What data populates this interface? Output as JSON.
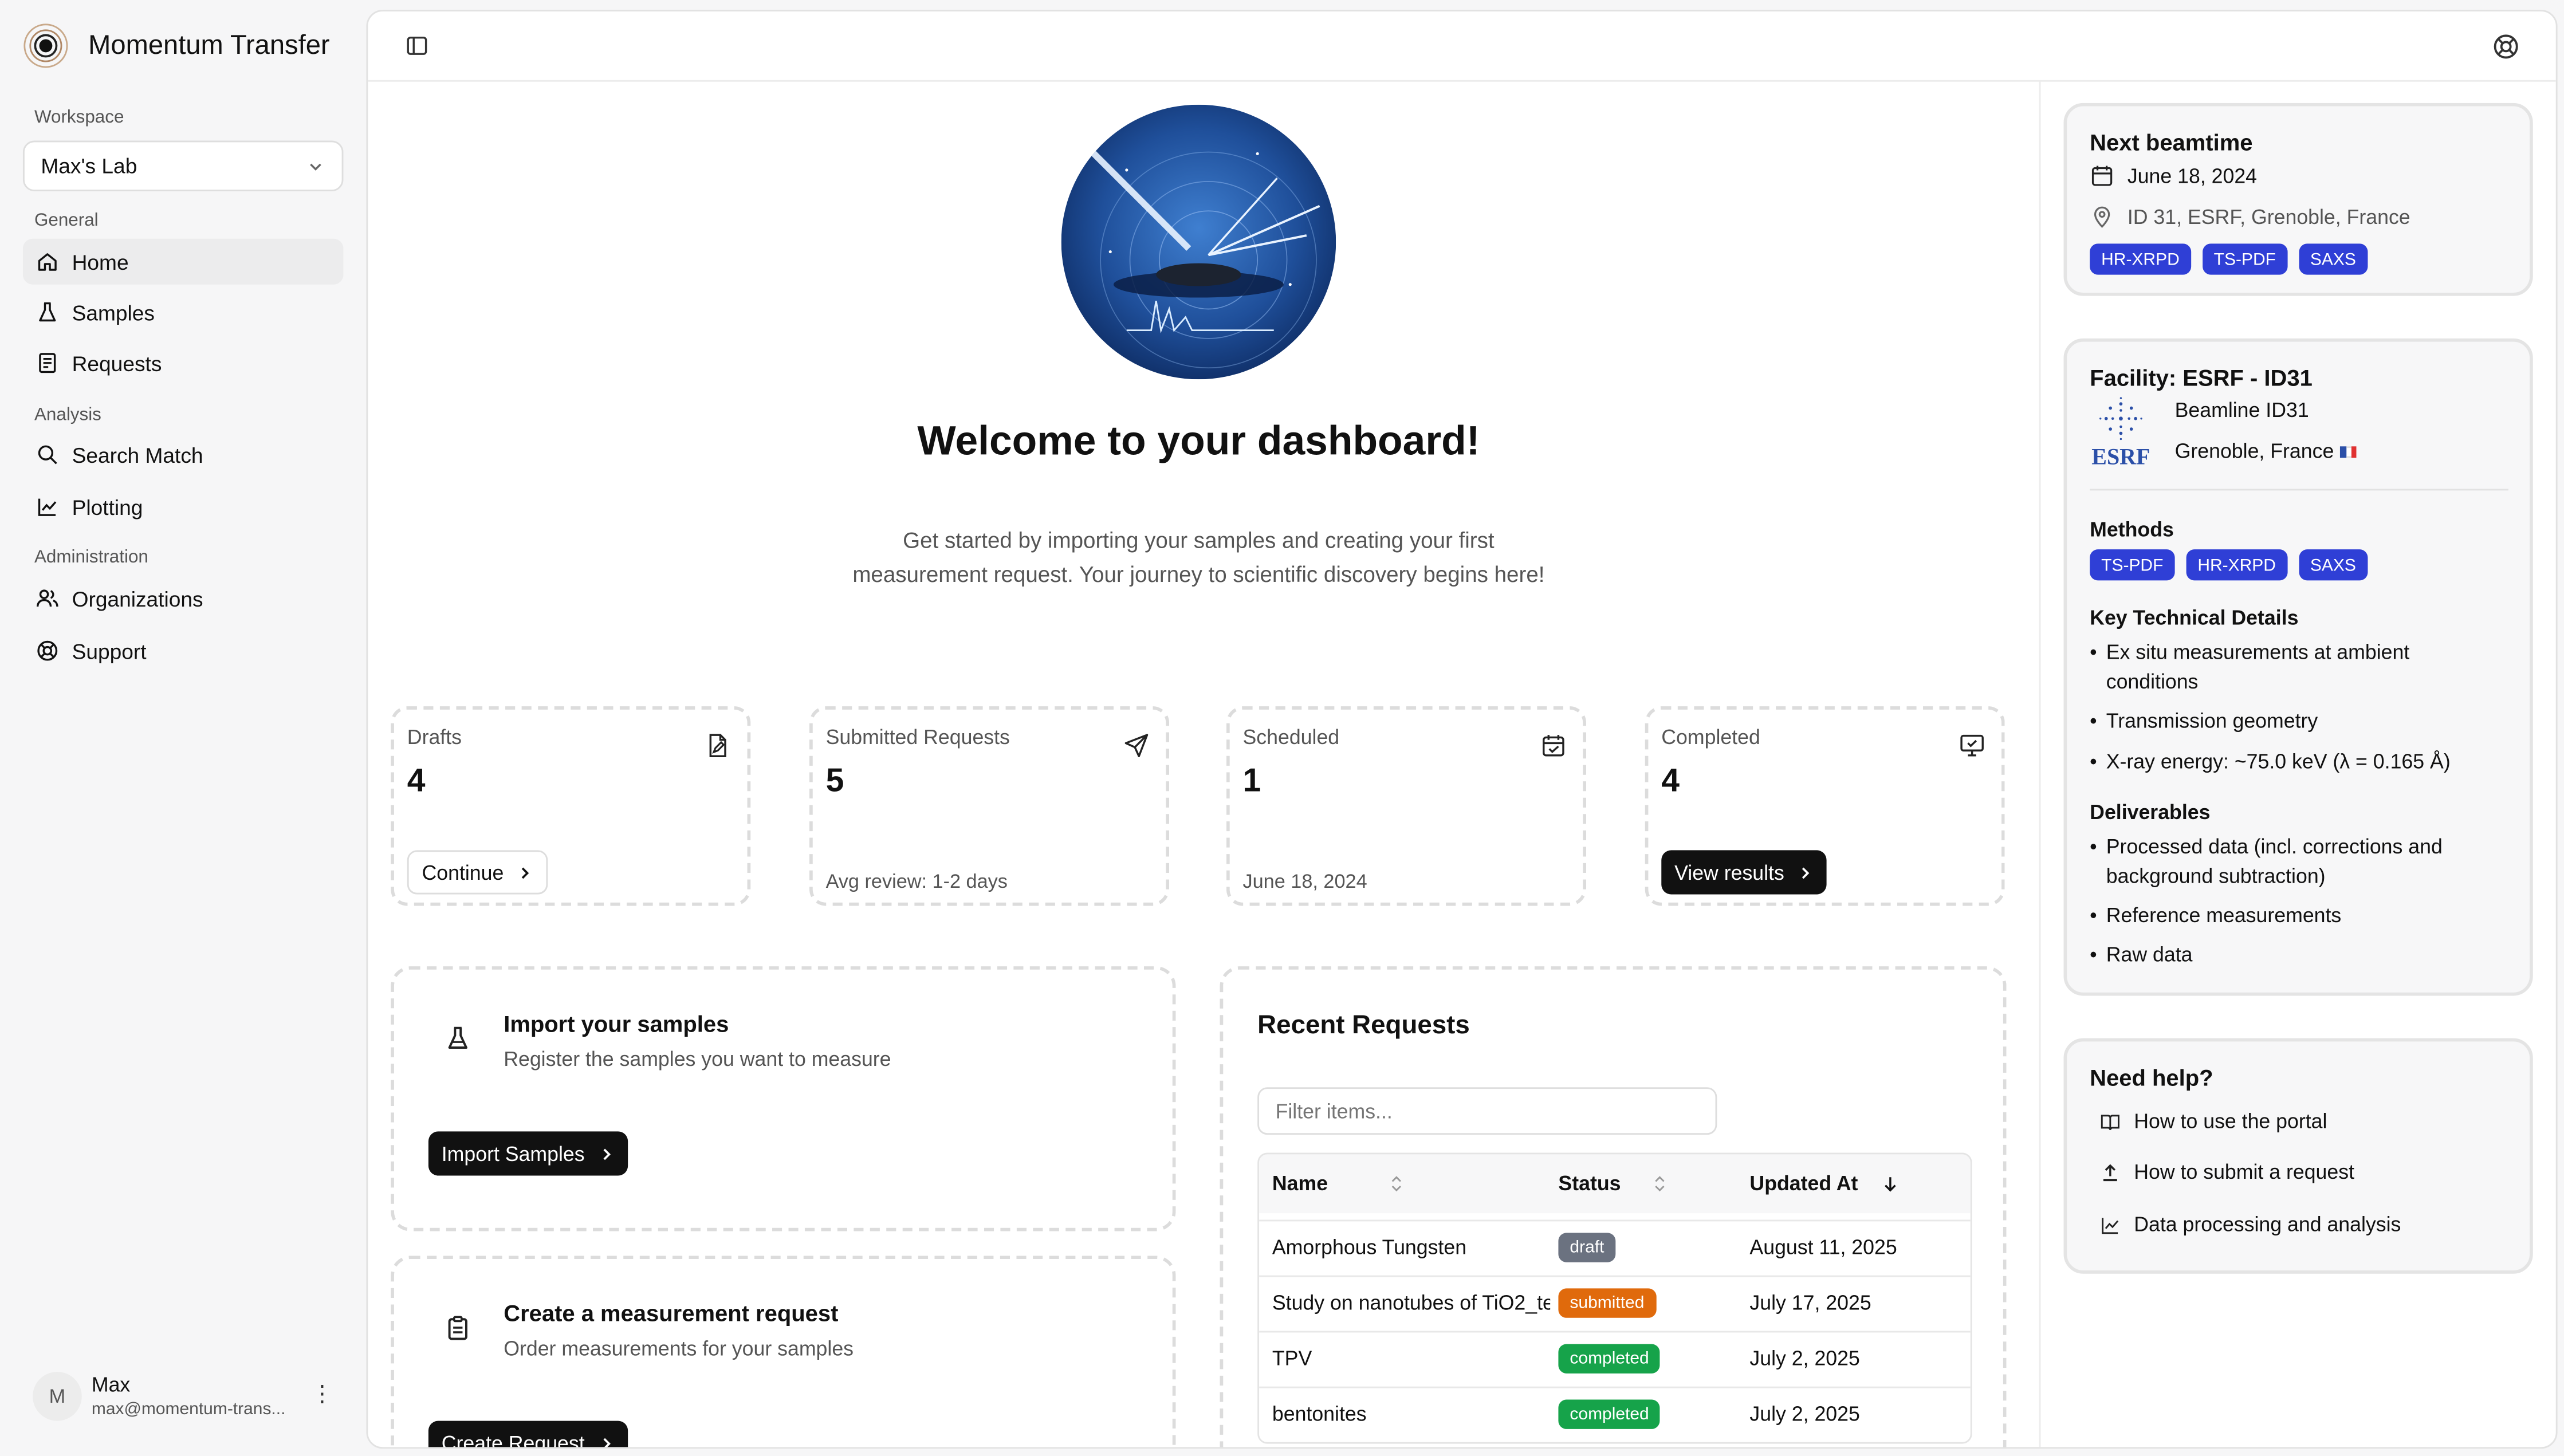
{
  "app": {
    "name": "Momentum Transfer"
  },
  "sidebar": {
    "workspace_label": "Workspace",
    "workspace_value": "Max's Lab",
    "groups": [
      {
        "label": "General",
        "items": [
          {
            "label": "Home"
          },
          {
            "label": "Samples"
          },
          {
            "label": "Requests"
          }
        ]
      },
      {
        "label": "Analysis",
        "items": [
          {
            "label": "Search Match"
          },
          {
            "label": "Plotting"
          }
        ]
      },
      {
        "label": "Administration",
        "items": [
          {
            "label": "Organizations"
          },
          {
            "label": "Support"
          }
        ]
      }
    ],
    "active_item": "Home"
  },
  "user": {
    "initial": "M",
    "name": "Max",
    "email": "max@momentum-trans..."
  },
  "main": {
    "welcome_title": "Welcome to your dashboard!",
    "intro_line1": "Get started by importing your samples and creating your first",
    "intro_line2": "measurement request. Your journey to scientific discovery begins here!",
    "stats": [
      {
        "label": "Drafts",
        "value": "4",
        "button": "Continue",
        "icon": "file-pen-icon"
      },
      {
        "label": "Submitted Requests",
        "value": "5",
        "foot": "Avg review: 1-2 days",
        "icon": "send-icon"
      },
      {
        "label": "Scheduled",
        "value": "1",
        "foot": "June 18, 2024",
        "icon": "calendar-check-icon"
      },
      {
        "label": "Completed",
        "value": "4",
        "button": "View results",
        "icon": "monitor-check-icon"
      }
    ],
    "import_card": {
      "title": "Import your samples",
      "subtitle": "Register the samples you want to measure",
      "button": "Import Samples"
    },
    "request_card": {
      "title": "Create a measurement request",
      "subtitle": "Order measurements for your samples",
      "button": "Create Request"
    },
    "recent": {
      "title": "Recent Requests",
      "filter_placeholder": "Filter items...",
      "columns": [
        "Name",
        "Status",
        "Updated At"
      ],
      "rows": [
        {
          "name": "Amorphous Tungsten",
          "status": "draft",
          "updated": "August 11, 2025"
        },
        {
          "name": "Study on nanotubes of TiO2_te",
          "status": "submitted",
          "updated": "July 17, 2025"
        },
        {
          "name": "TPV",
          "status": "completed",
          "updated": "July 2, 2025"
        },
        {
          "name": "bentonites",
          "status": "completed",
          "updated": "July 2, 2025"
        }
      ]
    }
  },
  "next_beamtime": {
    "title": "Next beamtime",
    "date": "June 18, 2024",
    "location": "ID 31, ESRF, Grenoble, France",
    "tags": [
      "HR-XRPD",
      "TS-PDF",
      "SAXS"
    ]
  },
  "facility": {
    "title": "Facility: ESRF - ID31",
    "logo_text": "ESRF",
    "beamline": "Beamline ID31",
    "city": "Grenoble, France",
    "methods_label": "Methods",
    "methods": [
      "TS-PDF",
      "HR-XRPD",
      "SAXS"
    ],
    "key_details_label": "Key Technical Details",
    "key_details": [
      "Ex situ measurements at ambient conditions",
      "Transmission geometry",
      "X-ray energy: ~75.0 keV (λ = 0.165 Å)"
    ],
    "deliverables_label": "Deliverables",
    "deliverables": [
      "Processed data (incl. corrections and background subtraction)",
      "Reference measurements",
      "Raw data"
    ]
  },
  "help": {
    "title": "Need help?",
    "items": [
      {
        "label": "How to use the portal",
        "icon": "book-icon"
      },
      {
        "label": "How to submit a request",
        "icon": "upload-icon"
      },
      {
        "label": "Data processing and analysis",
        "icon": "chart-icon"
      }
    ]
  },
  "colors": {
    "accent_chip": "#2f3fd6",
    "draft": "#6b7280",
    "submitted": "#e06a0c",
    "completed": "#16a34a"
  }
}
